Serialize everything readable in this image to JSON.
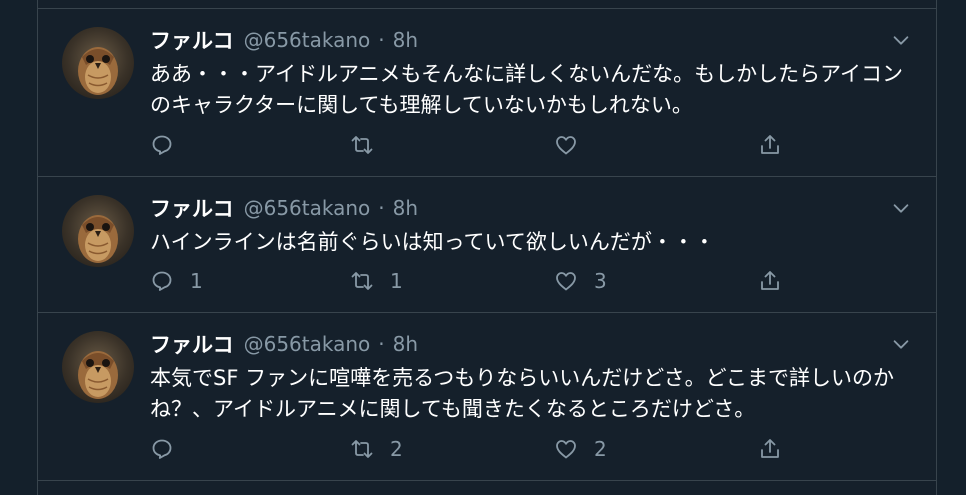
{
  "tweets": [
    {
      "name": "ファルコ",
      "handle": "@656takano",
      "separator": "·",
      "time": "8h",
      "text": "ああ・・・アイドルアニメもそんなに詳しくないんだな。もしかしたらアイコンのキャラクターに関しても理解していないかもしれない。",
      "replies": "",
      "retweets": "",
      "likes": ""
    },
    {
      "name": "ファルコ",
      "handle": "@656takano",
      "separator": "·",
      "time": "8h",
      "text": "ハインラインは名前ぐらいは知っていて欲しいんだが・・・",
      "replies": "1",
      "retweets": "1",
      "likes": "3"
    },
    {
      "name": "ファルコ",
      "handle": "@656takano",
      "separator": "·",
      "time": "8h",
      "text": "本気でSF ファンに喧嘩を売るつもりならいいんだけどさ。どこまで詳しいのかね？、アイドルアニメに関しても聞きたくなるところだけどさ。",
      "replies": "",
      "retweets": "2",
      "likes": "2"
    }
  ],
  "colors": {
    "background": "#15202b",
    "border": "#38444d",
    "text_primary": "#ffffff",
    "text_secondary": "#8899a6"
  },
  "icons": {
    "avatar": "owl-avatar",
    "reply": "reply-icon",
    "retweet": "retweet-icon",
    "like": "heart-icon",
    "share": "share-icon",
    "menu": "chevron-down-icon"
  }
}
